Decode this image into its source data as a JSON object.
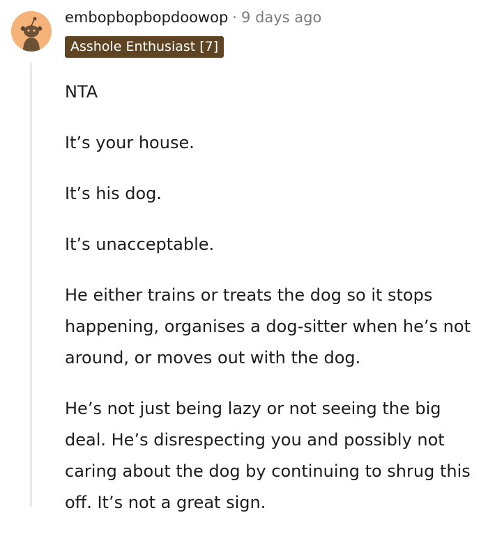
{
  "comment": {
    "username": "embopbopbopdoowop",
    "separator": "·",
    "timestamp": "9 days ago",
    "flair": "Asshole Enthusiast [7]",
    "avatar_icon": "snoo-avatar-icon",
    "colors": {
      "avatar_bg": "#f5b37a",
      "flair_bg": "#5e4422",
      "meta_text": "#7c7c7c",
      "thread_line": "#ebebeb"
    },
    "paragraphs": [
      "NTA",
      "It’s your house.",
      "It’s his dog.",
      "It’s unacceptable.",
      "He either trains or treats the dog so it stops happening, organises a dog-sitter when he’s not around, or moves out with the dog.",
      "He’s not just being lazy or not seeing the big deal. He’s disrespecting you and possibly not caring about the dog by continuing to shrug this off. It’s not a great sign."
    ]
  }
}
